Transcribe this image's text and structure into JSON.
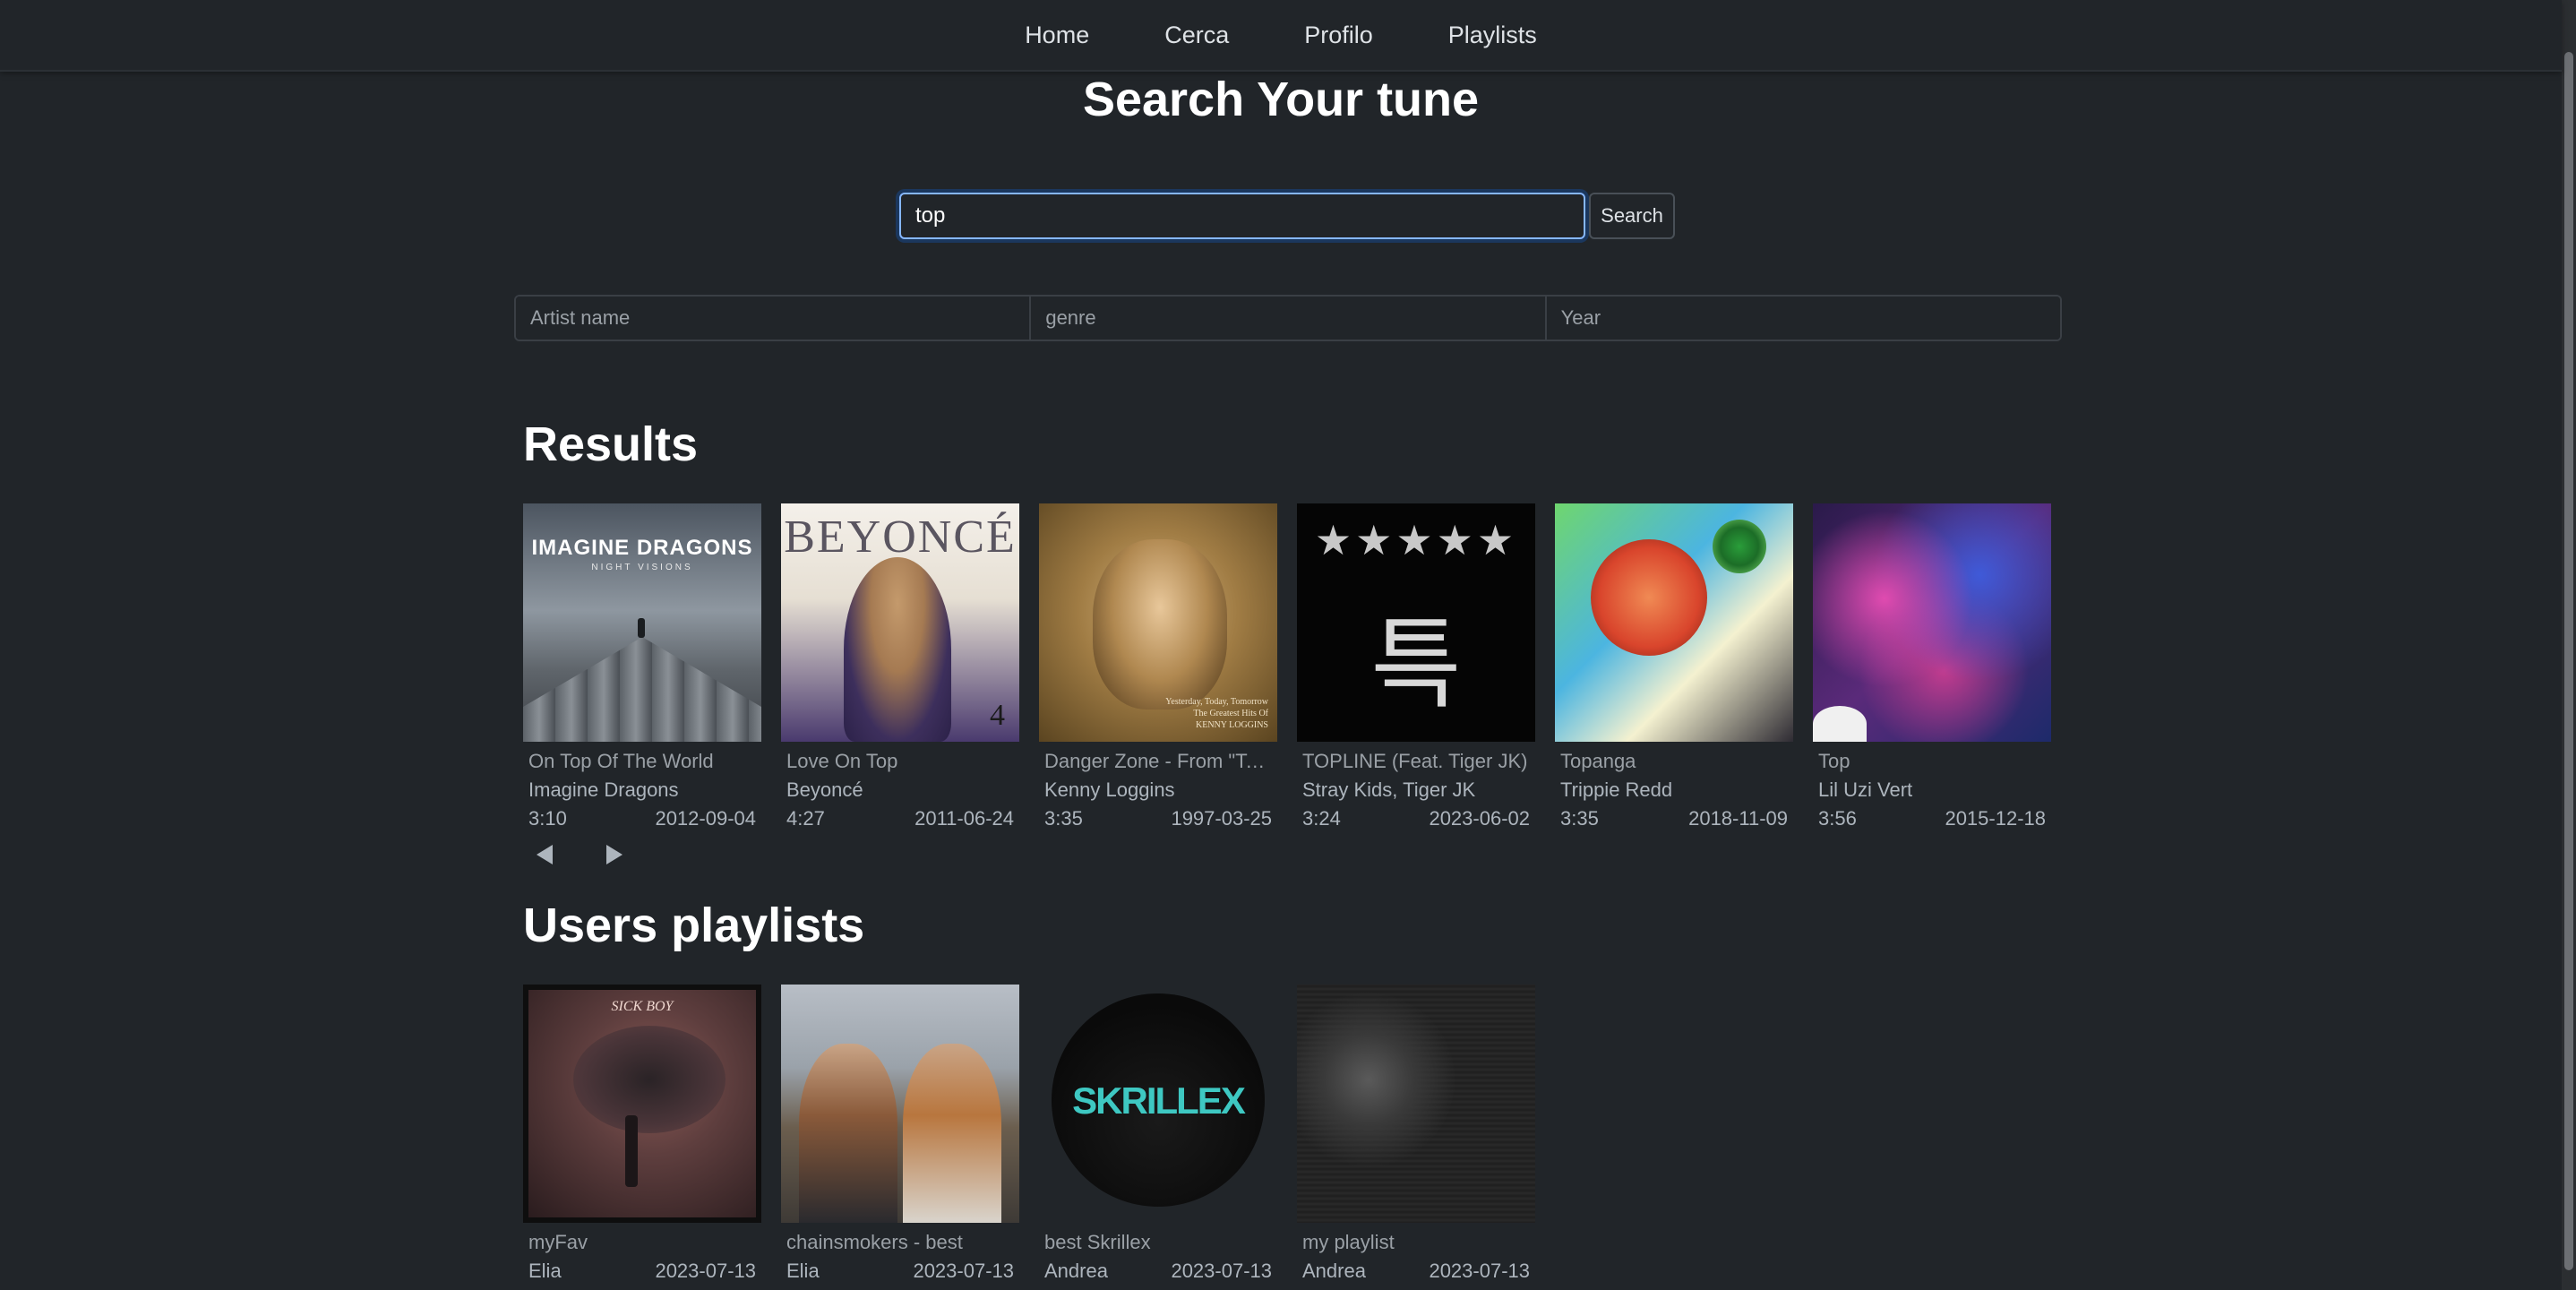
{
  "nav": {
    "items": [
      "Home",
      "Cerca",
      "Profilo",
      "Playlists"
    ]
  },
  "header": {
    "title": "Search Your tune"
  },
  "search": {
    "value": "top",
    "button_label": "Search"
  },
  "filters": {
    "artist_placeholder": "Artist name",
    "genre_placeholder": "genre",
    "year_placeholder": "Year"
  },
  "results": {
    "heading": "Results",
    "items": [
      {
        "title": "On Top Of The World",
        "artist": "Imagine Dragons",
        "duration": "3:10",
        "date": "2012-09-04",
        "cover_text": "IMAGINE DRAGONS",
        "cover_sub": "NIGHT VISIONS"
      },
      {
        "title": "Love On Top",
        "artist": "Beyoncé",
        "duration": "4:27",
        "date": "2011-06-24",
        "cover_text": "BEYONCÉ",
        "cover_sub": "4"
      },
      {
        "title": "Danger Zone - From \"To...",
        "artist": "Kenny Loggins",
        "duration": "3:35",
        "date": "1997-03-25",
        "cover_text": "Yesterday, Today, Tomorrow\nThe Greatest Hits Of\nKENNY LOGGINS"
      },
      {
        "title": "TOPLINE (Feat. Tiger JK)",
        "artist": "Stray Kids, Tiger JK",
        "duration": "3:24",
        "date": "2023-06-02",
        "cover_text": "★★★★★",
        "cover_sub": "특"
      },
      {
        "title": "Topanga",
        "artist": "Trippie Redd",
        "duration": "3:35",
        "date": "2018-11-09"
      },
      {
        "title": "Top",
        "artist": "Lil Uzi Vert",
        "duration": "3:56",
        "date": "2015-12-18"
      }
    ],
    "prev_icon": "chevron-left-icon",
    "next_icon": "chevron-right-icon"
  },
  "playlists": {
    "heading": "Users playlists",
    "items": [
      {
        "name": "myFav",
        "user": "Elia",
        "date": "2023-07-13",
        "cover_text": "SICK BOY"
      },
      {
        "name": "chainsmokers - best",
        "user": "Elia",
        "date": "2023-07-13"
      },
      {
        "name": "best Skrillex",
        "user": "Andrea",
        "date": "2023-07-13",
        "cover_text": "SKRILLEX"
      },
      {
        "name": "my playlist",
        "user": "Andrea",
        "date": "2023-07-13"
      }
    ]
  }
}
